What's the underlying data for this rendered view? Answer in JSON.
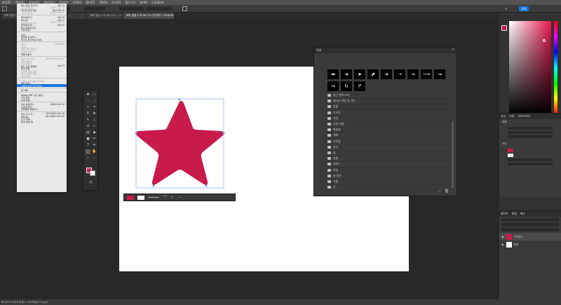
{
  "menubar": {
    "items": [
      "파일(F)",
      "편집(E)",
      "이미지(I)",
      "레이어(L)",
      "문자(Y)",
      "선택(S)",
      "필터(T)",
      "3D(D)",
      "보기(V)",
      "플러그인",
      "창(W)",
      "도움말(H)"
    ]
  },
  "tabs": [
    {
      "label": "제목 없음-1 @ 66.7% (사각형 1, RGB/8#) ×"
    },
    {
      "label": "제목 없음-2 @ 66.7% (...) ×"
    },
    {
      "label": "제목 없음-3 @ 66.7% (다각형 1, RGB/8#) ×"
    }
  ],
  "options": {
    "share_label": "공유"
  },
  "edit_menu": {
    "items": [
      {
        "label": "패스 편집 취소(O)",
        "shortcut": "Ctrl+Z",
        "state": "normal"
      },
      {
        "label": "다시 실행(O)",
        "shortcut": "Shift+Ctrl+Z",
        "state": "disabled"
      },
      {
        "label": "마지막 상태 전환",
        "shortcut": "Alt+Ctrl+Z",
        "state": "normal"
      },
      {
        "label": "사라지기(D)...",
        "shortcut": "Shift+Ctrl+F",
        "state": "disabled"
      },
      {
        "label": "",
        "shortcut": "",
        "state": "sep"
      },
      {
        "label": "잘라내기(T)",
        "shortcut": "Ctrl+X",
        "state": "normal"
      },
      {
        "label": "복사(C)",
        "shortcut": "Ctrl+C",
        "state": "normal"
      },
      {
        "label": "병합하여 복사(Y)",
        "shortcut": "Shift+Ctrl+C",
        "state": "disabled"
      },
      {
        "label": "붙여넣기(P)",
        "shortcut": "Ctrl+V",
        "state": "normal"
      },
      {
        "label": "특수 붙여넣기(I)",
        "shortcut": "",
        "state": "normal"
      },
      {
        "label": "지우기(E)",
        "shortcut": "",
        "state": "normal"
      },
      {
        "label": "",
        "shortcut": "",
        "state": "sep"
      },
      {
        "label": "검색",
        "shortcut": "",
        "state": "normal"
      },
      {
        "label": "맞춤법 검사(H)...",
        "shortcut": "",
        "state": "normal"
      },
      {
        "label": "텍스트 찾기/바꾸기(X)...",
        "shortcut": "",
        "state": "normal"
      },
      {
        "label": "",
        "shortcut": "",
        "state": "sep"
      },
      {
        "label": "칠(L)...",
        "shortcut": "Shift+F5",
        "state": "disabled"
      },
      {
        "label": "획(S)...",
        "shortcut": "",
        "state": "disabled"
      },
      {
        "label": "내용 인식 채우기...",
        "shortcut": "",
        "state": "disabled"
      },
      {
        "label": "생성형 채우기...",
        "shortcut": "",
        "state": "disabled"
      },
      {
        "label": "퍼펫 뒤틀기",
        "shortcut": "",
        "state": "normal"
      },
      {
        "label": "",
        "shortcut": "",
        "state": "sep"
      },
      {
        "label": "내용 인식 비율",
        "shortcut": "Alt+Shift+Ctrl+C",
        "state": "disabled"
      },
      {
        "label": "퍼펫 뒤틀기",
        "shortcut": "",
        "state": "disabled"
      },
      {
        "label": "원근 뒤틀기",
        "shortcut": "",
        "state": "disabled"
      },
      {
        "label": "패스 자유 변형(F)",
        "shortcut": "Ctrl+T",
        "state": "normal"
      },
      {
        "label": "패스 변형",
        "shortcut": "",
        "state": "normal"
      },
      {
        "label": "레이어 자동 정렬...",
        "shortcut": "",
        "state": "disabled"
      },
      {
        "label": "레이어 자동 혼합...",
        "shortcut": "",
        "state": "disabled"
      },
      {
        "label": "하늘 대체...",
        "shortcut": "",
        "state": "disabled"
      },
      {
        "label": "",
        "shortcut": "",
        "state": "sep"
      },
      {
        "label": "브러시 사전 설정 정의(B)...",
        "shortcut": "",
        "state": "disabled"
      },
      {
        "label": "패턴 정의...",
        "shortcut": "",
        "state": "normal"
      },
      {
        "label": "사용자 정의 모양 정의...",
        "shortcut": "",
        "state": "highlight"
      },
      {
        "label": "",
        "shortcut": "",
        "state": "sep"
      },
      {
        "label": "제거(R)",
        "shortcut": "",
        "state": "normal"
      },
      {
        "label": "",
        "shortcut": "",
        "state": "sep"
      },
      {
        "label": "Adobe PDF 사전 설정...",
        "shortcut": "",
        "state": "normal"
      },
      {
        "label": "사전 설정",
        "shortcut": "",
        "state": "normal"
      },
      {
        "label": "원격 연결...",
        "shortcut": "",
        "state": "normal"
      },
      {
        "label": "",
        "shortcut": "",
        "state": "sep"
      },
      {
        "label": "색상 설정(G)...",
        "shortcut": "Shift+Ctrl+K",
        "state": "normal"
      },
      {
        "label": "프로필 할당...",
        "shortcut": "",
        "state": "normal"
      },
      {
        "label": "프로필로 변환(V)...",
        "shortcut": "",
        "state": "normal"
      },
      {
        "label": "",
        "shortcut": "",
        "state": "sep"
      },
      {
        "label": "바로 가기 키...",
        "shortcut": "Alt+Shift+Ctrl+K",
        "state": "normal"
      },
      {
        "label": "메뉴(U)...",
        "shortcut": "Alt+Shift+Ctrl+M",
        "state": "normal"
      },
      {
        "label": "도구 모음...",
        "shortcut": "",
        "state": "normal"
      },
      {
        "label": "환경 설정(N)",
        "shortcut": "",
        "state": "normal"
      }
    ]
  },
  "shapes_panel": {
    "title": "모양",
    "folders": [
      "최근 항목 쓰기",
      "레거시 모양 및 기타",
      "동물",
      "오두막",
      "자연",
      "기본 도형",
      "화살표",
      "개체",
      "나뭇잎",
      "장식",
      "물",
      "원형",
      "자연2",
      "모양",
      "봄 풍선",
      "식물",
      "꽃"
    ]
  },
  "properties": {
    "title": "속성",
    "tab2": "조정",
    "tab3": "라이브러리",
    "section1": "변형",
    "section2": "모양"
  },
  "layers": {
    "title": "레이어",
    "tab2": "채널",
    "tab3": "패스",
    "layer1": "다각형 1",
    "layer2": "배경"
  },
  "statusbar": {
    "text": "66.67%    1000 픽셀 x 700 픽셀 (72 ppi)"
  },
  "colors": {
    "star": "#c91a4c",
    "accent": "#1473e6",
    "picker": "#e8174f"
  }
}
